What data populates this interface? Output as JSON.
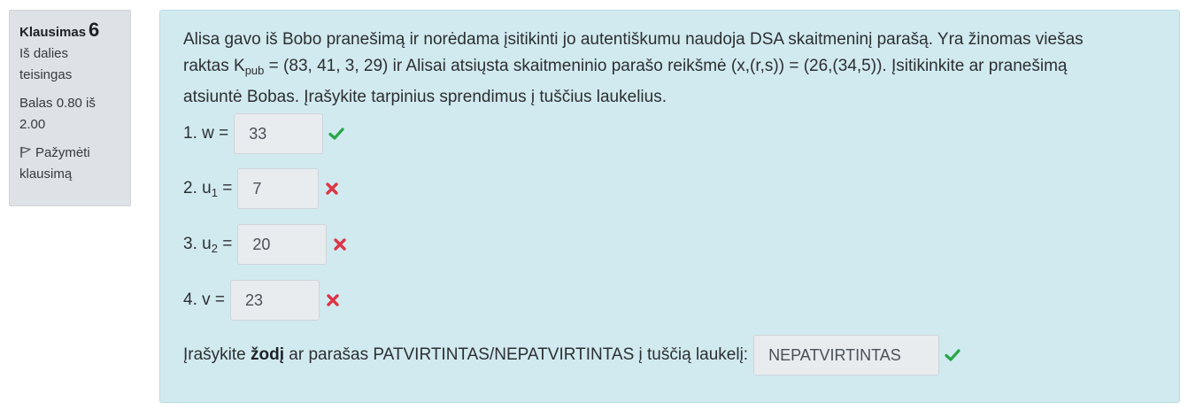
{
  "info": {
    "question_label": "Klausimas",
    "question_number": "6",
    "state_line1": "Iš dalies",
    "state_line2": "teisingas",
    "grade_line1": "Balas 0.80 iš",
    "grade_line2": "2.00",
    "flag_line1": "Pažymėti",
    "flag_line2": "klausimą"
  },
  "question": {
    "line1": "Alisa gavo iš Bobo pranešimą ir norėdama įsitikinti jo autentiškumu naudoja DSA skaitmeninį parašą. Yra žinomas viešas",
    "line2_pre": "raktas K",
    "line2_sub": "pub",
    "line2_post": " = (83, 41, 3, 29) ir Alisai atsiųsta skaitmeninio parašo reikšmė (x,(r,s)) = (26,(34,5)). Įsitikinkite ar pranešimą",
    "line3": "atsiuntė Bobas. Įrašykite tarpinius sprendimus į tuščius laukelius."
  },
  "answers": [
    {
      "label_pre": "1. w =",
      "label_sub": "",
      "label_post": "",
      "value": "33",
      "status": "correct"
    },
    {
      "label_pre": "2. u",
      "label_sub": "1",
      "label_post": " =",
      "value": "7",
      "status": "incorrect"
    },
    {
      "label_pre": "3. u",
      "label_sub": "2",
      "label_post": " =",
      "value": "20",
      "status": "incorrect"
    },
    {
      "label_pre": "4. v =",
      "label_sub": "",
      "label_post": "",
      "value": "23",
      "status": "incorrect"
    }
  ],
  "final": {
    "text_pre": "Įrašykite ",
    "text_bold": "žodį",
    "text_post": " ar parašas PATVIRTINTAS/NEPATVIRTINTAS į tuščią laukelį:",
    "value": "NEPATVIRTINTAS",
    "status": "correct"
  },
  "colors": {
    "correct": "#28a745",
    "incorrect": "#dc3545",
    "content_bg": "#d1eaf0",
    "info_bg": "#dee2e6"
  },
  "icons": {
    "correct": "check-icon",
    "incorrect": "cross-icon",
    "flag": "flag-icon"
  }
}
